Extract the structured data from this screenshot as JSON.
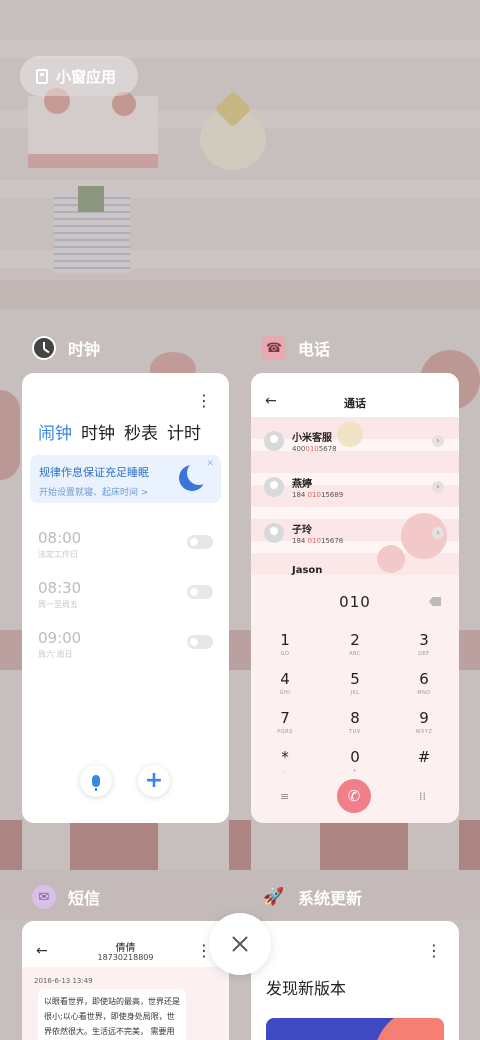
{
  "small_window": {
    "label": "小窗应用",
    "icon": "small-window-icon"
  },
  "apps": {
    "clock": {
      "title": "时钟",
      "tabs": [
        "闹钟",
        "时钟",
        "秒表",
        "计时"
      ],
      "active_tab": "闹钟",
      "banner": {
        "title": "规律作息保证充足睡眠",
        "subtitle": "开始设置就寝、起床时间 >"
      },
      "alarms": [
        {
          "time": "08:00",
          "desc": "法定工作日",
          "enabled": false
        },
        {
          "time": "08:30",
          "desc": "周一至周五",
          "enabled": false
        },
        {
          "time": "09:00",
          "desc": "周六 周日",
          "enabled": false
        }
      ],
      "accent": "#3a86e4"
    },
    "phone": {
      "title": "电话",
      "screen_title": "通话",
      "contacts": [
        {
          "name": "小米客服",
          "num_pre": "400",
          "num_hl": "010",
          "num_post": "5678"
        },
        {
          "name": "燕婷",
          "num_pre": "184 ",
          "num_hl": "010",
          "num_post": "15689"
        },
        {
          "name": "子玲",
          "num_pre": "184 ",
          "num_hl": "010",
          "num_post": "15678"
        },
        {
          "name": "Jason",
          "num_pre": "",
          "num_hl": "",
          "num_post": ""
        }
      ],
      "dialed": "010",
      "keys": [
        {
          "d": "1",
          "l": "GO"
        },
        {
          "d": "2",
          "l": "ABC"
        },
        {
          "d": "3",
          "l": "DEF"
        },
        {
          "d": "4",
          "l": "GHI"
        },
        {
          "d": "5",
          "l": "JKL"
        },
        {
          "d": "6",
          "l": "MNO"
        },
        {
          "d": "7",
          "l": "PQRS"
        },
        {
          "d": "8",
          "l": "TUV"
        },
        {
          "d": "9",
          "l": "WXYZ"
        },
        {
          "d": "*",
          "l": ","
        },
        {
          "d": "0",
          "l": "+"
        },
        {
          "d": "#",
          "l": ""
        }
      ],
      "call_color": "#f07f8a"
    },
    "sms": {
      "title": "短信",
      "contact_name": "倩倩",
      "contact_number": "18730218809",
      "date": "2016-6-13 13:49",
      "message": "以眼看世界，即使站的最高，世界还是很小;以心看世界，即使身处局限，世界依然很大。生活远不完美， 需要用心去体会;幸福没有太多，需"
    },
    "update": {
      "title": "系统更新",
      "heading": "发现新版本"
    }
  }
}
